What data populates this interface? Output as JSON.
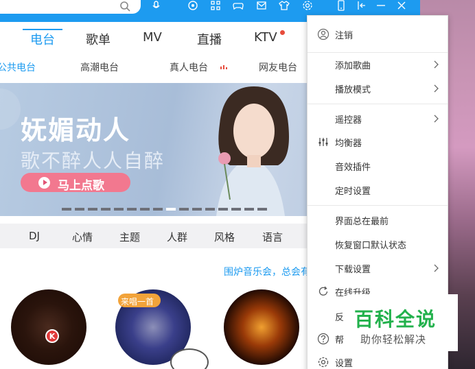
{
  "colors": {
    "accent": "#1d9bf0",
    "menu_text": "#333333",
    "watermark_green": "#22b14c",
    "badge": "#f2a33a"
  },
  "topbar": {
    "icons": [
      "search-icon",
      "microphone-icon",
      "record-icon",
      "app-grid-icon",
      "game-controller-icon",
      "mail-icon",
      "skin-icon",
      "settings-gear-icon",
      "mobile-phone-icon",
      "mini-mode-icon",
      "minimize-icon",
      "close-icon"
    ]
  },
  "nav": {
    "tabs": [
      {
        "label": "电台",
        "active": true
      },
      {
        "label": "歌单"
      },
      {
        "label": "MV"
      },
      {
        "label": "直播"
      },
      {
        "label": "KTV"
      }
    ]
  },
  "subnav": {
    "items": [
      {
        "label": "公共电台",
        "active": true
      },
      {
        "label": "高潮电台"
      },
      {
        "label": "真人电台"
      },
      {
        "label": "网友电台"
      }
    ]
  },
  "banner": {
    "title": "妩媚动人",
    "subtitle": "歌不醉人人自醉",
    "play_label": "马上点歌",
    "slide_count": 16,
    "active_slide": 8
  },
  "categories": [
    "DJ",
    "心情",
    "主题",
    "人群",
    "风格",
    "语言"
  ],
  "content": {
    "promo_link": "围炉音乐会，总会有",
    "disc_badge": "来唱一首",
    "k_logo": "K"
  },
  "menu": {
    "items": [
      {
        "label": "注销",
        "icon": "user-logout-icon",
        "chevron": false
      },
      {
        "label": "添加歌曲",
        "icon": "",
        "chevron": true
      },
      {
        "label": "播放模式",
        "icon": "",
        "chevron": true
      },
      {
        "label": "遥控器",
        "icon": "",
        "chevron": true
      },
      {
        "label": "均衡器",
        "icon": "equalizer-icon",
        "chevron": false
      },
      {
        "label": "音效插件",
        "icon": "",
        "chevron": false
      },
      {
        "label": "定时设置",
        "icon": "",
        "chevron": false
      },
      {
        "label": "界面总在最前",
        "icon": "",
        "chevron": false
      },
      {
        "label": "恢复窗口默认状态",
        "icon": "",
        "chevron": false
      },
      {
        "label": "下载设置",
        "icon": "",
        "chevron": true
      },
      {
        "label": "在线升级",
        "icon": "update-icon",
        "chevron": false
      },
      {
        "label": "",
        "icon": "",
        "chevron": false
      },
      {
        "label": "",
        "icon": "help-icon",
        "chevron": false
      },
      {
        "label": "设置",
        "icon": "settings-icon",
        "chevron": false
      }
    ],
    "partial_item_a": "反",
    "partial_item_b": "帮"
  },
  "watermark": {
    "title": "百科全说",
    "subtitle": "助你轻松解决"
  }
}
